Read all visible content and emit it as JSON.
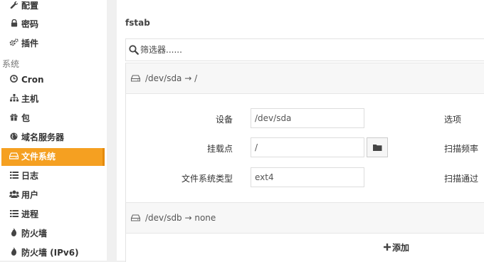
{
  "sidebar": {
    "items": [
      {
        "label": "配置",
        "icon": "wrench-icon"
      },
      {
        "label": "密码",
        "icon": "lock-icon"
      },
      {
        "label": "插件",
        "icon": "cogs-icon"
      },
      {
        "label": "Cron",
        "icon": "clock-icon"
      },
      {
        "label": "主机",
        "icon": "sitemap-icon"
      },
      {
        "label": "包",
        "icon": "gift-icon"
      },
      {
        "label": "域名服务器",
        "icon": "globe-icon"
      },
      {
        "label": "文件系统",
        "icon": "hdd-icon",
        "active": true
      },
      {
        "label": "日志",
        "icon": "list-icon"
      },
      {
        "label": "用户",
        "icon": "users-icon"
      },
      {
        "label": "进程",
        "icon": "list-icon"
      },
      {
        "label": "防火墙",
        "icon": "fire-icon"
      },
      {
        "label": "防火墙 (IPv6)",
        "icon": "fire-icon"
      }
    ],
    "section_label": "系统"
  },
  "main": {
    "title": "fstab",
    "search": {
      "placeholder": "筛选器......",
      "value": ""
    },
    "entries": [
      {
        "header": "/dev/sda → /"
      },
      {
        "header": "/dev/sdb → none"
      }
    ],
    "form": {
      "device_label": "设备",
      "device_value": "/dev/sda",
      "mount_label": "挂载点",
      "mount_value": "/",
      "type_label": "文件系统类型",
      "type_value": "ext4",
      "options_label": "选项",
      "freq_label": "扫描频率",
      "pass_label": "扫描通过"
    },
    "add_label": "添加"
  },
  "colors": {
    "accent": "#f5a021",
    "accent_border": "#e58a0c"
  }
}
